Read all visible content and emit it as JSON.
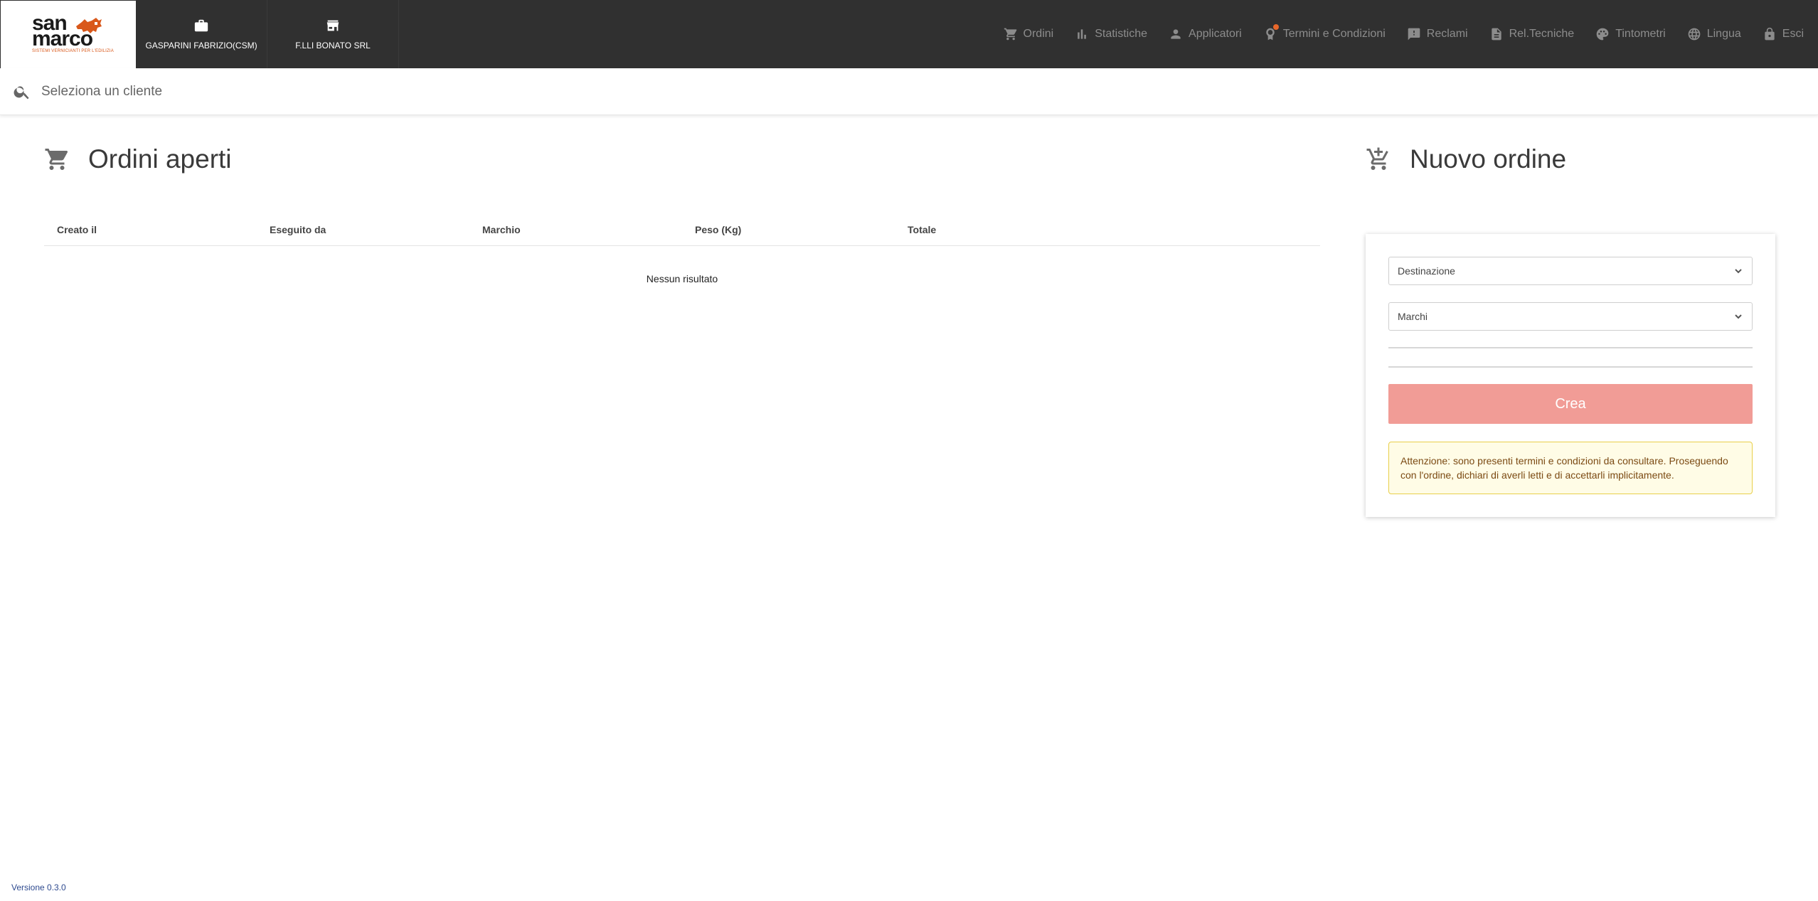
{
  "brand": {
    "line1": "san",
    "line2": "marco",
    "tagline": "SISTEMI VERNICIANTI PER L'EDILIZIA",
    "accent_color": "#d9581a"
  },
  "context": [
    {
      "icon": "briefcase-icon",
      "label": "GASPARINI FABRIZIO(CSM)"
    },
    {
      "icon": "store-icon",
      "label": "F.LLI BONATO SRL"
    }
  ],
  "nav": [
    {
      "icon": "cart-icon",
      "label": "Ordini"
    },
    {
      "icon": "bar-chart-icon",
      "label": "Statistiche"
    },
    {
      "icon": "person-icon",
      "label": "Applicatori"
    },
    {
      "icon": "badge-icon",
      "label": "Termini e Condizioni",
      "has_notification": true
    },
    {
      "icon": "feedback-icon",
      "label": "Reclami"
    },
    {
      "icon": "document-icon",
      "label": "Rel.Tecniche"
    },
    {
      "icon": "palette-icon",
      "label": "Tintometri"
    },
    {
      "icon": "globe-icon",
      "label": "Lingua"
    },
    {
      "icon": "lock-icon",
      "label": "Esci"
    }
  ],
  "search": {
    "placeholder": "Seleziona un cliente",
    "value": ""
  },
  "open_orders": {
    "title": "Ordini aperti",
    "columns": [
      "Creato il",
      "Eseguito da",
      "Marchio",
      "Peso (Kg)",
      "Totale"
    ],
    "rows": [],
    "empty_text": "Nessun risultato"
  },
  "new_order": {
    "title": "Nuovo ordine",
    "destination_label": "Destinazione",
    "brands_label": "Marchi",
    "create_label": "Crea",
    "create_color": "#f19c96",
    "warning_text": "Attenzione: sono presenti termini e condizioni da consultare. Proseguendo con l'ordine, dichiari di averli letti e di accettarli implicitamente."
  },
  "footer": {
    "version": "Versione 0.3.0"
  }
}
